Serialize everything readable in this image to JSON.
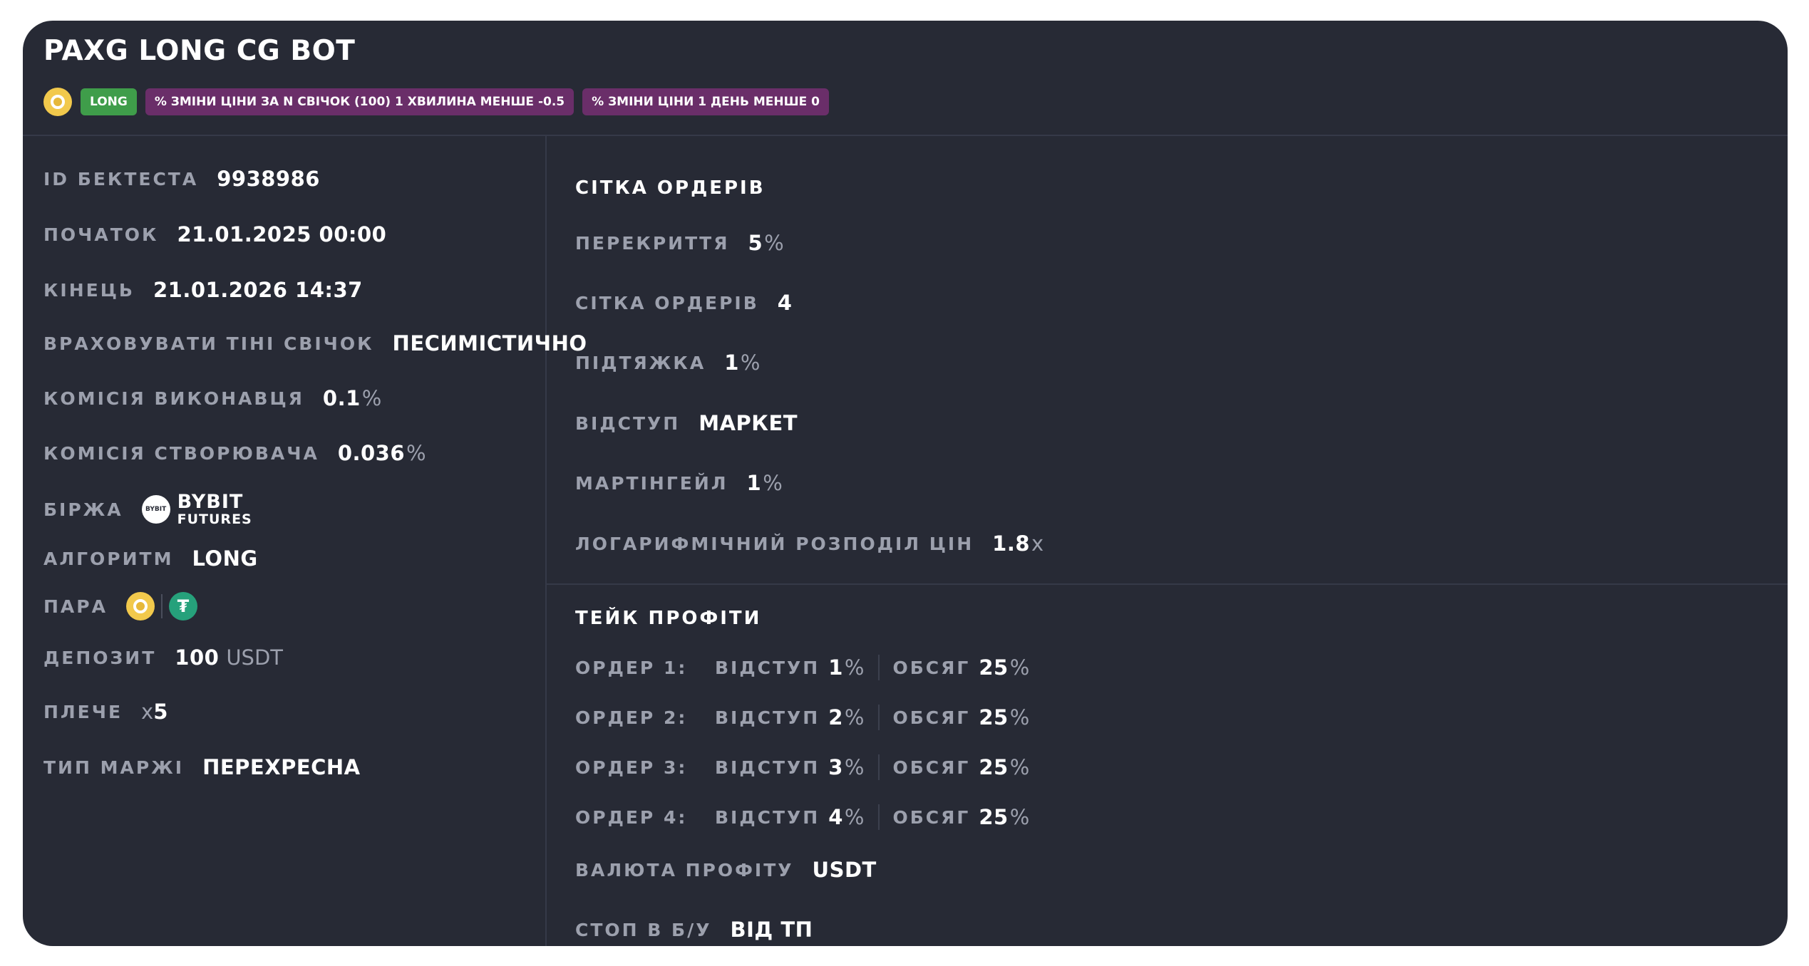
{
  "bot": {
    "title": "PAXG LONG CG BOT",
    "tags": {
      "direction": "LONG",
      "condition1": "% ЗМІНИ ЦІНИ ЗА N СВІЧОК (100) 1 ХВИЛИНА МЕНШЕ -0.5",
      "condition2": "% ЗМІНИ ЦІНИ 1 ДЕНЬ МЕНШЕ 0"
    }
  },
  "left": {
    "backtest_id": {
      "label": "ID БЕКТЕСТА",
      "value": "9938986"
    },
    "start": {
      "label": "ПОЧАТОК",
      "value": "21.01.2025 00:00"
    },
    "end": {
      "label": "КІНЕЦЬ",
      "value": "21.01.2026 14:37"
    },
    "wicks": {
      "label": "ВРАХОВУВАТИ ТІНІ СВІЧОК",
      "value": "ПЕСИМІСТИЧНО"
    },
    "taker_fee": {
      "label": "КОМІСІЯ ВИКОНАВЦЯ",
      "value": "0.1",
      "unit": "%"
    },
    "maker_fee": {
      "label": "КОМІСІЯ СТВОРЮВАЧА",
      "value": "0.036",
      "unit": "%"
    },
    "exchange": {
      "label": "БІРЖА",
      "logo_text": "BYBIT",
      "name": "BYBIT",
      "sub": "FUTURES"
    },
    "algorithm": {
      "label": "АЛГОРИТМ",
      "value": "LONG"
    },
    "pair": {
      "label": "ПАРА",
      "base_icon": "paxg-coin-icon",
      "quote_icon": "tether-coin-icon",
      "quote_glyph": "₮"
    },
    "deposit": {
      "label": "ДЕПОЗИТ",
      "value": "100",
      "unit": "USDT"
    },
    "leverage": {
      "label": "ПЛЕЧЕ",
      "prefix": "x",
      "value": "5"
    },
    "margin_type": {
      "label": "ТИП МАРЖІ",
      "value": "ПЕРЕХРЕСНА"
    }
  },
  "grid": {
    "title": "СІТКА ОРДЕРІВ",
    "overlap": {
      "label": "ПЕРЕКРИТТЯ",
      "value": "5",
      "unit": "%"
    },
    "orders": {
      "label": "СІТКА ОРДЕРІВ",
      "value": "4"
    },
    "pullup": {
      "label": "ПІДТЯЖКА",
      "value": "1",
      "unit": "%"
    },
    "offset": {
      "label": "ВІДСТУП",
      "value": "МАРКЕТ"
    },
    "martingale": {
      "label": "МАРТІНГЕЙЛ",
      "value": "1",
      "unit": "%"
    },
    "log_dist": {
      "label": "ЛОГАРИФМІЧНИЙ РОЗПОДІЛ ЦІН",
      "value": "1.8",
      "unit": "x"
    }
  },
  "take_profits": {
    "title": "ТЕЙК ПРОФІТИ",
    "orders": [
      {
        "label": "ОРДЕР 1:",
        "offset_label": "ВІДСТУП",
        "offset": "1",
        "offset_unit": "%",
        "volume_label": "ОБСЯГ",
        "volume": "25",
        "volume_unit": "%"
      },
      {
        "label": "ОРДЕР 2:",
        "offset_label": "ВІДСТУП",
        "offset": "2",
        "offset_unit": "%",
        "volume_label": "ОБСЯГ",
        "volume": "25",
        "volume_unit": "%"
      },
      {
        "label": "ОРДЕР 3:",
        "offset_label": "ВІДСТУП",
        "offset": "3",
        "offset_unit": "%",
        "volume_label": "ОБСЯГ",
        "volume": "25",
        "volume_unit": "%"
      },
      {
        "label": "ОРДЕР 4:",
        "offset_label": "ВІДСТУП",
        "offset": "4",
        "offset_unit": "%",
        "volume_label": "ОБСЯГ",
        "volume": "25",
        "volume_unit": "%"
      }
    ],
    "profit_currency": {
      "label": "ВАЛЮТА ПРОФІТУ",
      "value": "USDT"
    },
    "breakeven_stop": {
      "label": "СТОП В Б/У",
      "value": "ВІД ТП"
    }
  },
  "colors": {
    "card_bg": "#272a35",
    "label": "#9ca0ad",
    "long_tag": "#3f9d4a",
    "condition_tag": "#6a2e69",
    "paxg": "#f2c94c",
    "tether": "#26a17b"
  }
}
